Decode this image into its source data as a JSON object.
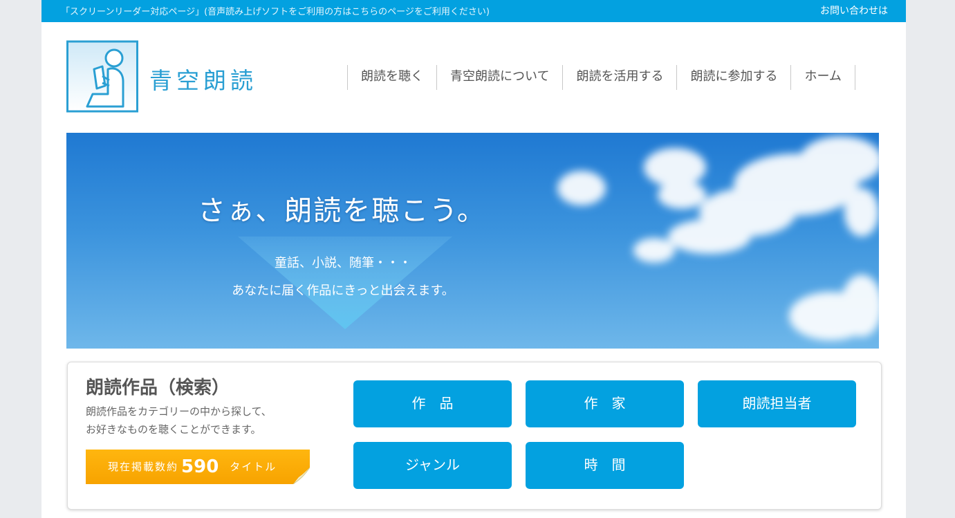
{
  "topbar": {
    "screen_reader_note": "「スクリーンリーダー対応ページ」(音声読み上げソフトをご利用の方はこちらのページをご利用ください)",
    "contact": "お問い合わせは"
  },
  "logo": {
    "text": "青空朗読"
  },
  "nav": {
    "items": [
      "朗読を聴く",
      "青空朗読について",
      "朗読を活用する",
      "朗読に参加する",
      "ホーム"
    ]
  },
  "hero": {
    "title": "さぁ、朗読を聴こう。",
    "line1": "童話、小説、随筆・・・",
    "line2": "あなたに届く作品にきっと出会えます。"
  },
  "search": {
    "title": "朗読作品（検索）",
    "desc_line1": "朗読作品をカテゴリーの中から探して、",
    "desc_line2": "お好きなものを聴くことができます。",
    "count_prefix": "現在掲載数約",
    "count_value": "590",
    "count_suffix": "タイトル",
    "buttons": [
      "作　品",
      "作　家",
      "朗読担当者",
      "ジャンル",
      "時　間"
    ]
  },
  "colors": {
    "accent": "#03a1e0",
    "tag": "#f7a300",
    "logo": "#2a9fd3"
  }
}
